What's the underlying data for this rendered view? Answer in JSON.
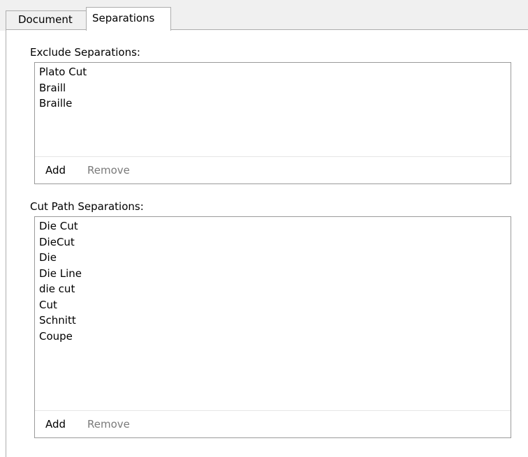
{
  "tabs": [
    {
      "label": "Document",
      "active": false
    },
    {
      "label": "Separations",
      "active": true
    }
  ],
  "exclude": {
    "label": "Exclude Separations:",
    "items": [
      "Plato Cut",
      "Braill",
      "Braille"
    ],
    "add_label": "Add",
    "remove_label": "Remove",
    "remove_enabled": false
  },
  "cutpath": {
    "label": "Cut Path Separations:",
    "items": [
      "Die Cut",
      "DieCut",
      "Die",
      "Die Line",
      "die cut",
      "Cut",
      "Schnitt",
      "Coupe"
    ],
    "add_label": "Add",
    "remove_label": "Remove",
    "remove_enabled": false
  },
  "colors": {
    "tabbar_bg": "#f0f0f0",
    "border": "#adadad",
    "disabled_text": "#7a7a7a"
  }
}
